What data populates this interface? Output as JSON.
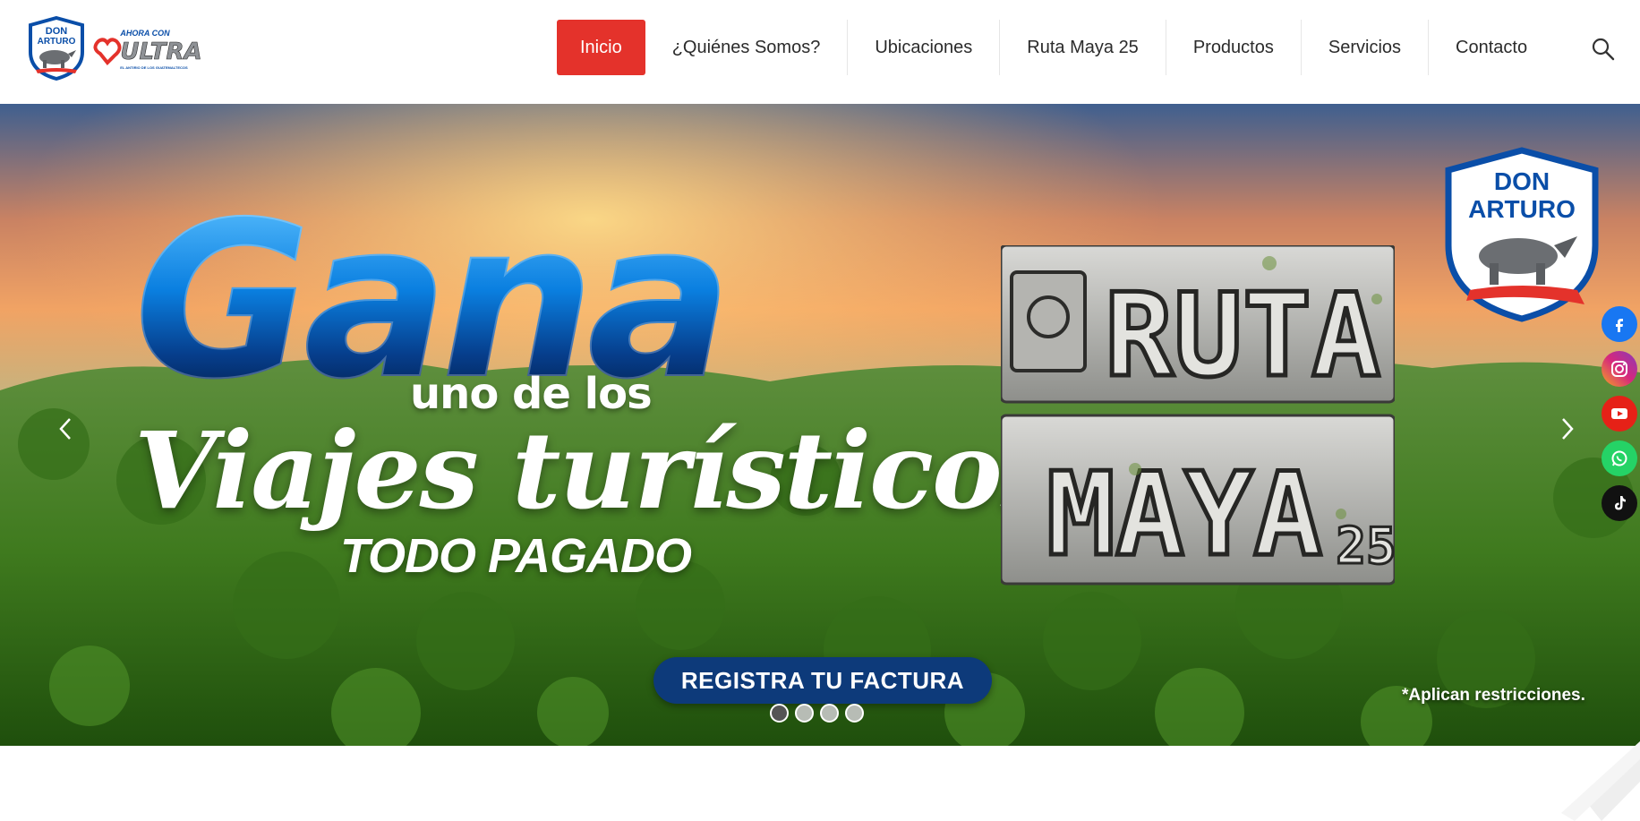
{
  "header": {
    "logo_brand_top": "DON",
    "logo_brand_bottom": "ARTURO",
    "logo_ultra_tag": "AHORA CON",
    "logo_ultra_name": "ULTRA",
    "logo_ultra_slogan": "EL ANTIRIO DE LOS GUATEMALTECOS"
  },
  "nav": {
    "items": [
      {
        "label": "Inicio",
        "active": true
      },
      {
        "label": "¿Quiénes Somos?",
        "active": false
      },
      {
        "label": "Ubicaciones",
        "active": false
      },
      {
        "label": "Ruta Maya 25",
        "active": false
      },
      {
        "label": "Productos",
        "active": false
      },
      {
        "label": "Servicios",
        "active": false
      },
      {
        "label": "Contacto",
        "active": false
      }
    ],
    "search_icon": "search-icon"
  },
  "hero": {
    "headline": "Gana",
    "line2": "uno de los",
    "line3": "Viajes turísticos",
    "line4": "TODO PAGADO",
    "ruta_line1": "RUTA",
    "ruta_line2": "MAYA",
    "ruta_number": "25",
    "badge_top": "DON",
    "badge_bottom": "ARTURO",
    "cta_label": "REGISTRA TU FACTURA",
    "restrictions": "*Aplican restricciones.",
    "slides_total": 4,
    "slide_active": 1
  },
  "social": [
    {
      "name": "facebook-icon",
      "color": "#1877f2"
    },
    {
      "name": "instagram-icon",
      "color": "#d6287c"
    },
    {
      "name": "youtube-icon",
      "color": "#e62117"
    },
    {
      "name": "whatsapp-icon",
      "color": "#25d366"
    },
    {
      "name": "tiktok-icon",
      "color": "#111111"
    }
  ],
  "colors": {
    "accent": "#e4322b",
    "cta": "#0d3a7a",
    "brand_blue": "#0a4ea8"
  }
}
